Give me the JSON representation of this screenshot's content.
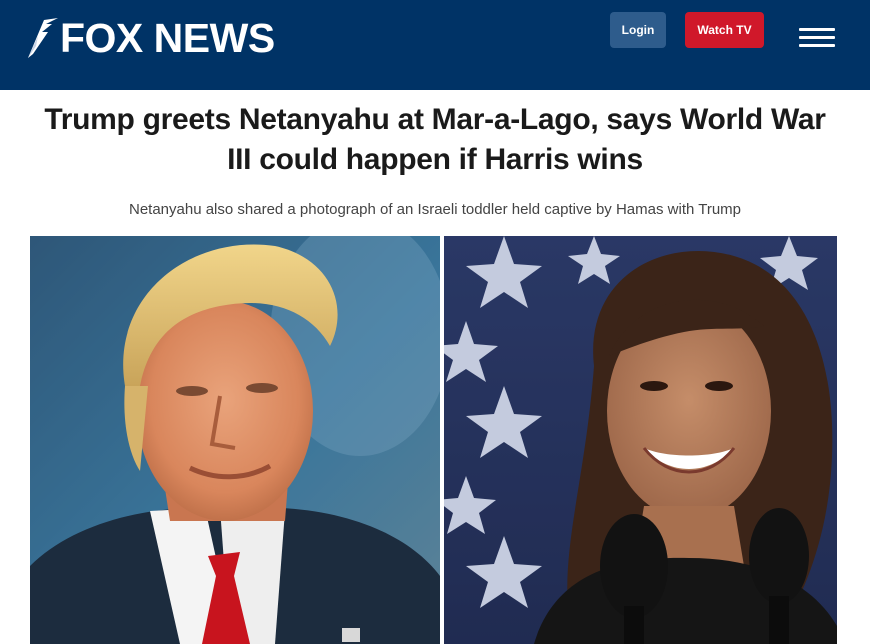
{
  "header": {
    "logo_text": "FOX NEWS",
    "login_label": "Login",
    "watch_tv_label": "Watch TV",
    "background_color": "#003366",
    "watch_tv_color": "#d0182a",
    "login_color": "#2e5c8c",
    "menu_icon": "hamburger-menu-icon"
  },
  "article": {
    "headline": "Trump greets Netanyahu at Mar-a-Lago, says World War III could happen if Harris wins",
    "subheadline": "Netanyahu also shared a photograph of an Israeli toddler held captive by Hamas with Trump"
  }
}
